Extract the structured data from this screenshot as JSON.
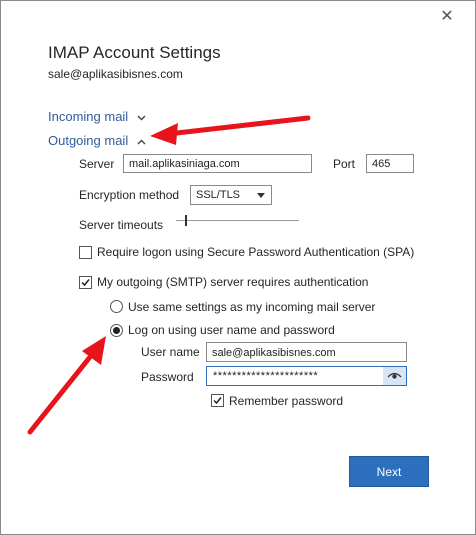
{
  "dialog": {
    "close_glyph": "✕",
    "title": "IMAP Account Settings",
    "email": "sale@aplikasibisnes.com"
  },
  "sections": {
    "incoming_label": "Incoming mail",
    "outgoing_label": "Outgoing mail"
  },
  "outgoing": {
    "server_label": "Server",
    "server_value": "mail.aplikasiniaga.com",
    "port_label": "Port",
    "port_value": "465",
    "encryption_label": "Encryption method",
    "encryption_value": "SSL/TLS",
    "timeouts_label": "Server timeouts",
    "timeout_level": 0.07,
    "spa_label": "Require logon using Secure Password Authentication (SPA)",
    "spa_checked": false,
    "smtp_auth_label": "My outgoing (SMTP) server requires authentication",
    "smtp_auth_checked": true,
    "same_settings_label": "Use same settings as my incoming mail server",
    "logon_label": "Log on using user name and password",
    "selected_option": "logon",
    "username_label": "User name",
    "username_value": "sale@aplikasibisnes.com",
    "password_label": "Password",
    "password_value": "**********************",
    "remember_label": "Remember password",
    "remember_checked": true
  },
  "buttons": {
    "next_label": "Next"
  },
  "colors": {
    "accent": "#2b6fbd",
    "link": "#2f5d99",
    "annotation_arrow": "#e8141b"
  },
  "icons": [
    "close-icon",
    "chevron-down-icon",
    "chevron-up-icon",
    "dropdown-arrow-icon",
    "eye-icon",
    "checkmark-icon",
    "red-arrow-annotation"
  ]
}
